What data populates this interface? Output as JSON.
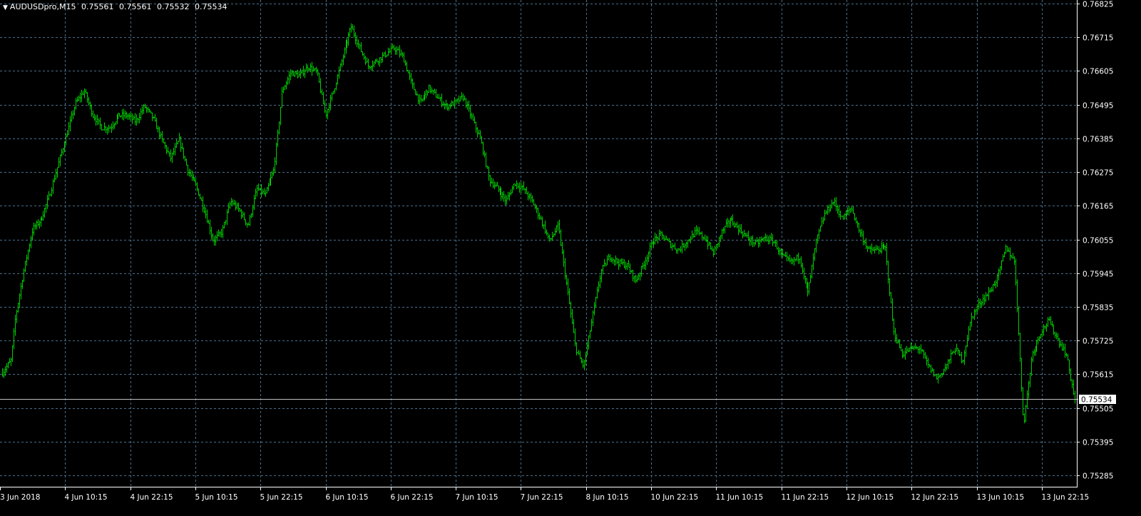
{
  "header": {
    "symbol_timeframe": "AUDUSDpro,M15",
    "open": "0.75561",
    "high": "0.75561",
    "low": "0.75532",
    "close": "0.75534",
    "dropdown_icon": "triangle-down-icon"
  },
  "colors": {
    "background": "#000000",
    "grid": "#4a6e8a",
    "bars": "#00d000",
    "axis_text": "#ffffff",
    "current_price_line": "#c0c0c0",
    "price_badge_bg": "#ffffff",
    "price_badge_text": "#000000"
  },
  "chart_data": {
    "type": "bar",
    "style": "OHLC price bars",
    "symbol": "AUDUSDpro",
    "timeframe": "M15",
    "current_price": 0.75534,
    "current_price_label": "0.75534",
    "y_ticks": [
      "0.76825",
      "0.76715",
      "0.76605",
      "0.76495",
      "0.76385",
      "0.76275",
      "0.76165",
      "0.76055",
      "0.75945",
      "0.75835",
      "0.75725",
      "0.75615",
      "0.75505",
      "0.75395",
      "0.75285"
    ],
    "x_ticks": [
      "3 Jun 2018",
      "4 Jun 10:15",
      "4 Jun 22:15",
      "5 Jun 10:15",
      "5 Jun 22:15",
      "6 Jun 10:15",
      "6 Jun 22:15",
      "7 Jun 10:15",
      "7 Jun 22:15",
      "8 Jun 10:15",
      "10 Jun 22:15",
      "11 Jun 10:15",
      "11 Jun 22:15",
      "12 Jun 10:15",
      "12 Jun 22:15",
      "13 Jun 10:15",
      "13 Jun 22:15"
    ],
    "grid": true,
    "price_path": [
      [
        0,
        0.7562
      ],
      [
        0.01,
        0.7566
      ],
      [
        0.015,
        0.758
      ],
      [
        0.025,
        0.7596
      ],
      [
        0.035,
        0.7609
      ],
      [
        0.045,
        0.7612
      ],
      [
        0.055,
        0.762
      ],
      [
        0.065,
        0.763
      ],
      [
        0.075,
        0.764
      ],
      [
        0.085,
        0.765
      ],
      [
        0.095,
        0.7654
      ],
      [
        0.105,
        0.7646
      ],
      [
        0.115,
        0.7642
      ],
      [
        0.125,
        0.7642
      ],
      [
        0.135,
        0.7646
      ],
      [
        0.145,
        0.7646
      ],
      [
        0.155,
        0.7644
      ],
      [
        0.165,
        0.7649
      ],
      [
        0.175,
        0.7645
      ],
      [
        0.185,
        0.7638
      ],
      [
        0.195,
        0.7632
      ],
      [
        0.205,
        0.7638
      ],
      [
        0.215,
        0.7628
      ],
      [
        0.225,
        0.7623
      ],
      [
        0.235,
        0.7615
      ],
      [
        0.245,
        0.7605
      ],
      [
        0.255,
        0.7608
      ],
      [
        0.265,
        0.7618
      ],
      [
        0.275,
        0.7615
      ],
      [
        0.285,
        0.761
      ],
      [
        0.295,
        0.7622
      ],
      [
        0.305,
        0.762
      ],
      [
        0.315,
        0.7628
      ],
      [
        0.32,
        0.764
      ],
      [
        0.325,
        0.7654
      ],
      [
        0.335,
        0.766
      ],
      [
        0.345,
        0.7659
      ],
      [
        0.355,
        0.7662
      ],
      [
        0.365,
        0.766
      ],
      [
        0.375,
        0.7646
      ],
      [
        0.385,
        0.7655
      ],
      [
        0.395,
        0.7665
      ],
      [
        0.405,
        0.7675
      ],
      [
        0.415,
        0.7668
      ],
      [
        0.425,
        0.7662
      ],
      [
        0.435,
        0.7664
      ],
      [
        0.445,
        0.7666
      ],
      [
        0.455,
        0.7668
      ],
      [
        0.465,
        0.7665
      ],
      [
        0.475,
        0.7656
      ],
      [
        0.485,
        0.765
      ],
      [
        0.495,
        0.7655
      ],
      [
        0.505,
        0.7652
      ],
      [
        0.515,
        0.7649
      ],
      [
        0.525,
        0.765
      ],
      [
        0.535,
        0.7652
      ],
      [
        0.545,
        0.7645
      ],
      [
        0.555,
        0.7638
      ],
      [
        0.565,
        0.7625
      ],
      [
        0.575,
        0.7622
      ],
      [
        0.585,
        0.7618
      ],
      [
        0.595,
        0.7624
      ],
      [
        0.605,
        0.7622
      ],
      [
        0.615,
        0.7618
      ],
      [
        0.625,
        0.7612
      ],
      [
        0.635,
        0.7605
      ],
      [
        0.645,
        0.761
      ],
      [
        0.655,
        0.759
      ],
      [
        0.665,
        0.757
      ],
      [
        0.675,
        0.7564
      ],
      [
        0.685,
        0.758
      ],
      [
        0.695,
        0.7595
      ],
      [
        0.705,
        0.76
      ],
      [
        0.715,
        0.7598
      ],
      [
        0.725,
        0.7597
      ],
      [
        0.735,
        0.7592
      ],
      [
        0.745,
        0.7598
      ],
      [
        0.755,
        0.7605
      ],
      [
        0.765,
        0.7607
      ],
      [
        0.775,
        0.7604
      ],
      [
        0.785,
        0.7602
      ],
      [
        0.795,
        0.7605
      ],
      [
        0.805,
        0.7608
      ],
      [
        0.815,
        0.7606
      ],
      [
        0.825,
        0.7601
      ],
      [
        0.835,
        0.7608
      ],
      [
        0.845,
        0.7612
      ],
      [
        0.855,
        0.7609
      ],
      [
        0.865,
        0.7606
      ],
      [
        0.875,
        0.7604
      ],
      [
        0.885,
        0.7606
      ],
      [
        0.895,
        0.7605
      ],
      [
        0.905,
        0.76
      ],
      [
        0.915,
        0.7598
      ],
      [
        0.925,
        0.76
      ],
      [
        0.935,
        0.7588
      ],
      [
        0.945,
        0.7605
      ],
      [
        0.955,
        0.7614
      ],
      [
        0.965,
        0.7618
      ],
      [
        0.975,
        0.7612
      ],
      [
        0.985,
        0.7616
      ],
      [
        0.995,
        0.7608
      ],
      [
        1.005,
        0.7602
      ],
      [
        1.015,
        0.7602
      ],
      [
        1.025,
        0.7603
      ],
      [
        1.035,
        0.7575
      ],
      [
        1.045,
        0.7568
      ],
      [
        1.055,
        0.757
      ],
      [
        1.065,
        0.757
      ],
      [
        1.075,
        0.7564
      ],
      [
        1.085,
        0.756
      ],
      [
        1.095,
        0.7564
      ],
      [
        1.105,
        0.757
      ],
      [
        1.115,
        0.7566
      ],
      [
        1.125,
        0.758
      ],
      [
        1.135,
        0.7585
      ],
      [
        1.145,
        0.7588
      ],
      [
        1.155,
        0.7593
      ],
      [
        1.165,
        0.7603
      ],
      [
        1.175,
        0.7598
      ],
      [
        1.185,
        0.7545
      ],
      [
        1.195,
        0.7568
      ],
      [
        1.205,
        0.7575
      ],
      [
        1.215,
        0.7579
      ],
      [
        1.225,
        0.7573
      ],
      [
        1.235,
        0.7568
      ],
      [
        1.245,
        0.7553
      ]
    ]
  }
}
